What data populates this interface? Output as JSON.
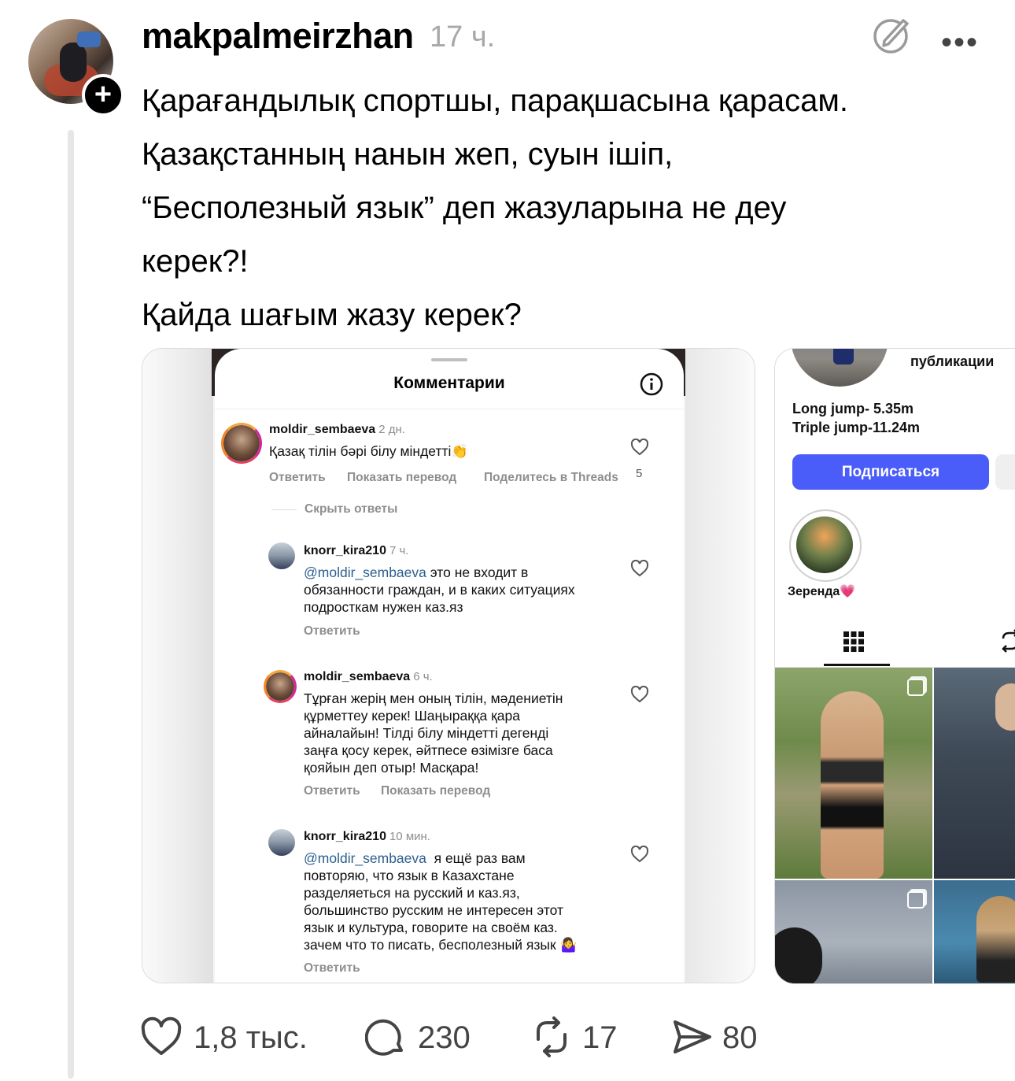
{
  "post": {
    "username": "makpalmeirzhan",
    "time": "17 ч.",
    "text_lines": [
      "Қарағандылық спортшы, парақшасына қарасам.",
      "Қазақстанның нанын жеп, суын ішіп,",
      "“Бесполезный язык” деп жазуларына не деу",
      "керек?!",
      "Қайда шағым жазу керек?"
    ]
  },
  "screenshot1": {
    "title": "Комментарии",
    "comments": [
      {
        "user": "moldir_sembaeva",
        "time": "2 дн.",
        "text": "Қазақ тілін бәрі білу міндетті👏",
        "actions": [
          "Ответить",
          "Показать перевод",
          "Поделитесь в Threads"
        ],
        "likes": "5",
        "toggle": "Скрыть ответы"
      },
      {
        "user": "knorr_kira210",
        "time": "7 ч.",
        "mention": "@moldir_sembaeva",
        "text_lines": [
          " это не входит в",
          "обязанности граждан, и в каких ситуациях",
          "подросткам нужен каз.яз"
        ],
        "actions": [
          "Ответить"
        ]
      },
      {
        "user": "moldir_sembaeva",
        "time": "6 ч.",
        "text_lines": [
          "Тұрған жерің мен оның тілін, мәдениетін",
          "құрметтеу керек! Шаңыраққа қара",
          "айналайын! Тілді білу міндетті дегенді",
          "заңға қосу керек, әйтпесе өзімізге баса",
          "қояйын деп отыр! Масқара!"
        ],
        "actions": [
          "Ответить",
          "Показать перевод"
        ]
      },
      {
        "user": "knorr_kira210",
        "time": "10 мин.",
        "mention": "@moldir_sembaeva",
        "text_lines": [
          "  я ещё раз вам",
          "повторяю, что язык в Казахстане",
          "разделяеться на русский и каз.яз,",
          "большинство русским не интересен этот",
          "язык и культура, говорите на своём каз.",
          "зачем что то писать, бесполезный язык 🤷‍♀️"
        ],
        "actions": [
          "Ответить"
        ]
      }
    ]
  },
  "screenshot2": {
    "posts_label": "публикации",
    "bio": [
      "Long jump- 5.35m",
      "Triple jump-11.24m"
    ],
    "follow_button": "Подписаться",
    "highlight_label": "Зеренда💗"
  },
  "actions": {
    "likes": "1,8 тыс.",
    "comments": "230",
    "reposts": "17",
    "shares": "80"
  },
  "colors": {
    "follow_blue": "#4a5df9",
    "muted_gray": "#a8a8a8",
    "mention_blue": "#2d5f8e"
  }
}
